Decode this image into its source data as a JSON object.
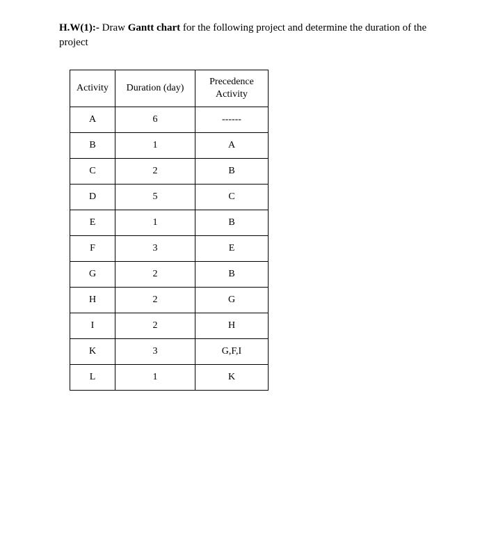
{
  "heading": {
    "prefix": "H.W(1):- ",
    "action": "Draw ",
    "bold_term": "Gantt chart",
    "rest": " for the following project and determine the duration of the project"
  },
  "table": {
    "headers": {
      "activity": "Activity",
      "duration": "Duration (day)",
      "precedence": "Precedence Activity"
    },
    "rows": [
      {
        "activity": "A",
        "duration": "6",
        "precedence": "------"
      },
      {
        "activity": "B",
        "duration": "1",
        "precedence": "A"
      },
      {
        "activity": "C",
        "duration": "2",
        "precedence": "B"
      },
      {
        "activity": "D",
        "duration": "5",
        "precedence": "C"
      },
      {
        "activity": "E",
        "duration": "1",
        "precedence": "B"
      },
      {
        "activity": "F",
        "duration": "3",
        "precedence": "E"
      },
      {
        "activity": "G",
        "duration": "2",
        "precedence": "B"
      },
      {
        "activity": "H",
        "duration": "2",
        "precedence": "G"
      },
      {
        "activity": "I",
        "duration": "2",
        "precedence": "H"
      },
      {
        "activity": "K",
        "duration": "3",
        "precedence": "G,F,I"
      },
      {
        "activity": "L",
        "duration": "1",
        "precedence": "K"
      }
    ]
  }
}
